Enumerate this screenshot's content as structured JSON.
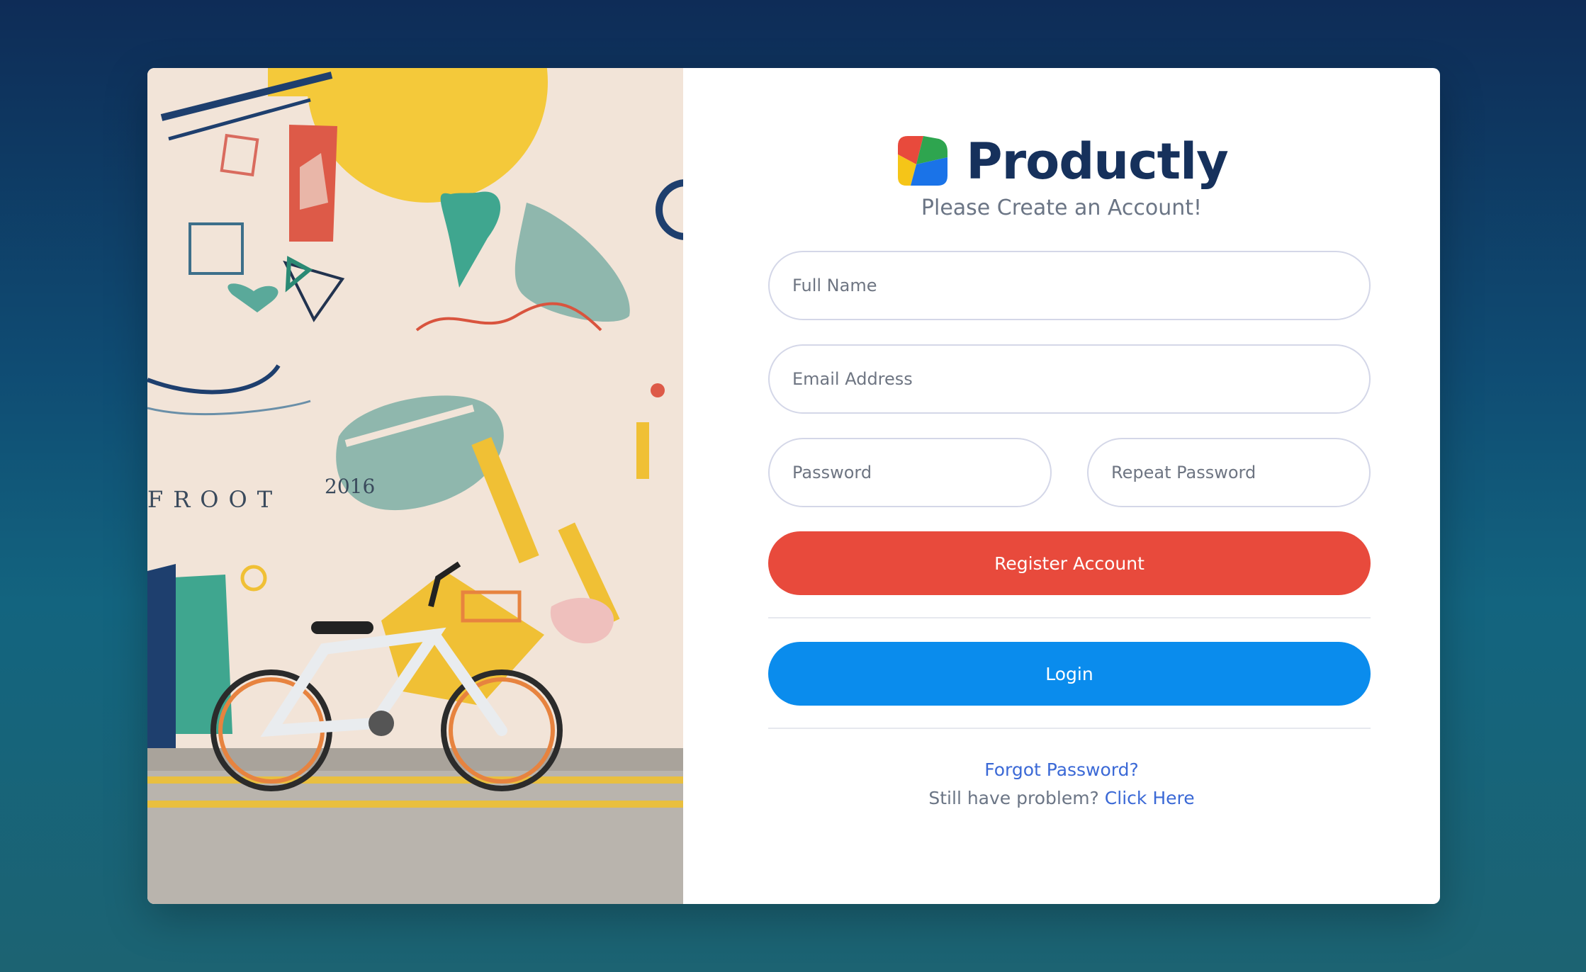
{
  "brand": {
    "name": "Productly",
    "logo_colors": [
      "#e84a3c",
      "#2ea54f",
      "#f5c518",
      "#1a73e8"
    ]
  },
  "form": {
    "subtitle": "Please Create an Account!",
    "full_name_placeholder": "Full Name",
    "email_placeholder": "Email Address",
    "password_placeholder": "Password",
    "repeat_password_placeholder": "Repeat Password",
    "register_label": "Register Account",
    "login_label": "Login"
  },
  "links": {
    "forgot_password": "Forgot Password?",
    "problem_text": "Still have problem?",
    "click_here": "Click Here"
  },
  "mural": {
    "wall_text": "FROOT",
    "year_text": "2016"
  },
  "colors": {
    "register_button": "#e84a3c",
    "login_button": "#0a8ced",
    "link": "#3b69d6",
    "brand_text": "#16315c"
  }
}
